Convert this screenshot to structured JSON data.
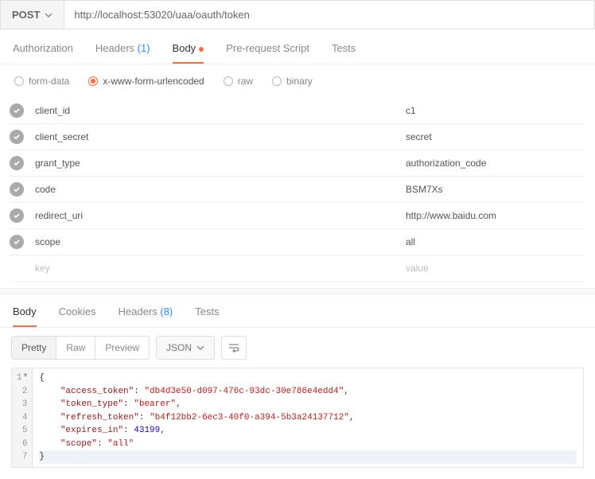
{
  "request": {
    "method": "POST",
    "url": "http://localhost:53020/uaa/oauth/token"
  },
  "req_tabs": {
    "authorization": "Authorization",
    "headers": "Headers",
    "headers_count": "(1)",
    "body": "Body",
    "prerequest": "Pre-request Script",
    "tests": "Tests"
  },
  "body_types": {
    "formdata": "form-data",
    "urlencoded": "x-www-form-urlencoded",
    "raw": "raw",
    "binary": "binary"
  },
  "params": [
    {
      "key": "client_id",
      "value": "c1"
    },
    {
      "key": "client_secret",
      "value": "secret"
    },
    {
      "key": "grant_type",
      "value": "authorization_code"
    },
    {
      "key": "code",
      "value": "BSM7Xs"
    },
    {
      "key": "redirect_uri",
      "value": "http://www.baidu.com"
    },
    {
      "key": "scope",
      "value": "all"
    }
  ],
  "placeholder": {
    "key": "key",
    "value": "value"
  },
  "resp_tabs": {
    "body": "Body",
    "cookies": "Cookies",
    "headers": "Headers",
    "headers_count": "(8)",
    "tests": "Tests"
  },
  "viewmodes": {
    "pretty": "Pretty",
    "raw": "Raw",
    "preview": "Preview"
  },
  "format": "JSON",
  "response": {
    "access_token": "db4d3e50-d097-476c-93dc-30e786e4edd4",
    "token_type": "bearer",
    "refresh_token": "b4f12bb2-6ec3-40f0-a394-5b3a24137712",
    "expires_in": 43199,
    "scope": "all"
  }
}
